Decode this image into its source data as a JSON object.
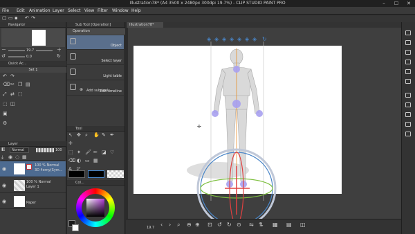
{
  "window": {
    "title": "Illustration78* (A4 3500 x 2480px 300dpi 19.7%)  - CLIP STUDIO PAINT PRO",
    "minimize": "–",
    "maximize": "☐",
    "close": "✕"
  },
  "menu": [
    "File",
    "Edit",
    "Animation",
    "Layer",
    "Select",
    "View",
    "Filter",
    "Window",
    "Help"
  ],
  "navigator": {
    "title": "Navigator",
    "zoom": "19.7",
    "angle": "0.0"
  },
  "sub_tool": {
    "title": "Sub Tool [Operation]",
    "tab": "Operation",
    "items": [
      "Object",
      "Select layer",
      "Light table",
      "Edit timeline"
    ],
    "add_label": "Add sub tool"
  },
  "quick_access": {
    "title": "Quick Ac...",
    "set": "Set 1"
  },
  "tool_panel": {
    "title": "Tool"
  },
  "canvas_tab": {
    "label": "Illustration78*"
  },
  "layer": {
    "title": "Layer",
    "blend_mode": "Normal",
    "opacity": "100",
    "rows": [
      {
        "line1": "100 % Normal",
        "line2": "3D 4emy(Sym..."
      },
      {
        "line1": "100 % Normal",
        "line2": "Layer 1"
      },
      {
        "line1": "",
        "line2": "Paper"
      }
    ]
  },
  "color_wheel": {
    "title": "Col..."
  },
  "status": {
    "zoom": "19.7"
  },
  "colors": {
    "accent": "#4a86c8",
    "background": "#2b2b2b",
    "panel": "#3b3b3b",
    "paper": "#ffffff",
    "joint": "#a8a0f0",
    "main_color": "#1b1b1b",
    "sub_color": "#ffffff"
  }
}
